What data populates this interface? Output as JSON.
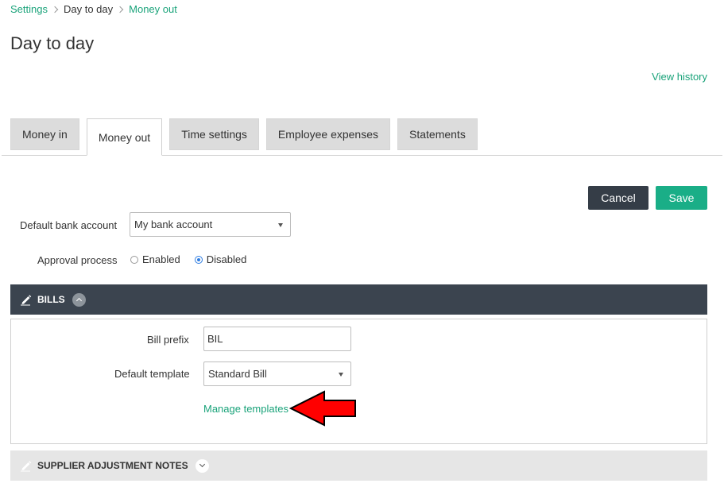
{
  "breadcrumb": {
    "items": [
      {
        "label": "Settings"
      },
      {
        "label": "Day to day"
      },
      {
        "label": "Money out"
      }
    ]
  },
  "page": {
    "title": "Day to day",
    "view_history": "View history"
  },
  "tabs": [
    {
      "label": "Money in"
    },
    {
      "label": "Money out",
      "active": true
    },
    {
      "label": "Time settings"
    },
    {
      "label": "Employee expenses"
    },
    {
      "label": "Statements"
    }
  ],
  "actions": {
    "cancel": "Cancel",
    "save": "Save"
  },
  "form": {
    "default_bank_account": {
      "label": "Default bank account",
      "value": "My bank account"
    },
    "approval_process": {
      "label": "Approval process",
      "options": [
        {
          "label": "Enabled",
          "selected": false
        },
        {
          "label": "Disabled",
          "selected": true
        }
      ]
    }
  },
  "bills": {
    "title": "BILLS",
    "expanded": true,
    "bill_prefix": {
      "label": "Bill prefix",
      "value": "BIL"
    },
    "default_template": {
      "label": "Default template",
      "value": "Standard Bill"
    },
    "manage_templates": "Manage templates"
  },
  "supplier_adjustment_notes": {
    "title": "SUPPLIER ADJUSTMENT NOTES",
    "expanded": false
  },
  "colors": {
    "accent": "#1aa37a",
    "save_button": "#1aae87",
    "cancel_button": "#353d47",
    "bills_header": "#3b444f",
    "annotation_arrow": "#ff0000"
  },
  "icons": {
    "breadcrumb_separator": "chevron-right-icon",
    "section_icon": "pencil-icon",
    "collapse": "chevron-up-icon",
    "expand": "chevron-down-icon",
    "select_caret": "caret-down-icon",
    "annotation": "red-arrow-left-icon"
  }
}
